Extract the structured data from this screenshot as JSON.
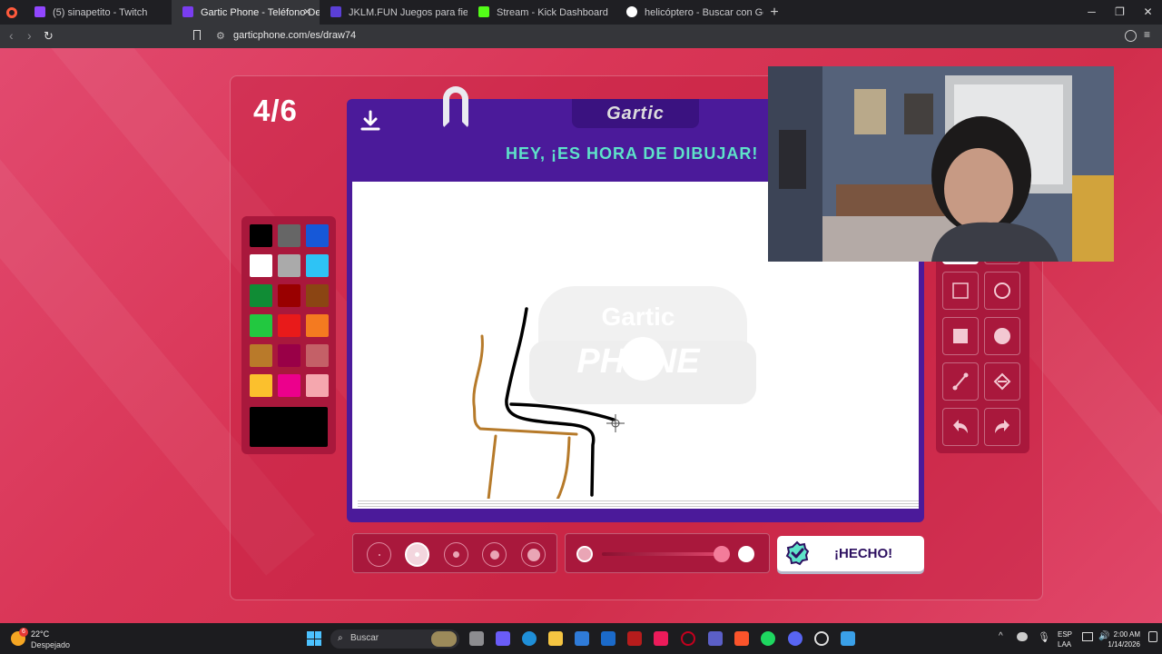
{
  "browser": {
    "tabs": [
      {
        "label": "(5) sinapetito - Twitch",
        "favicon_color": "#9146ff",
        "active": false
      },
      {
        "label": "Gartic Phone - Teléfono Descom",
        "favicon_color": "#7a3df0",
        "active": true
      },
      {
        "label": "JKLM.FUN Juegos para fiestas en PC",
        "favicon_color": "#5b3fd6",
        "active": false
      },
      {
        "label": "Stream - Kick Dashboard",
        "favicon_color": "#53fc18",
        "active": false
      },
      {
        "label": "helicóptero - Buscar con Google",
        "favicon_color": "#ffffff",
        "active": false
      }
    ],
    "url": "garticphone.com/es/draw74"
  },
  "game": {
    "round_counter": "4/6",
    "logo": "Gartic",
    "watermark_top": "Gartic",
    "watermark_bottom": "PHONE",
    "prompt": "HEY, ¡ES HORA DE DIBUJAR!",
    "palette": [
      "#000000",
      "#666666",
      "#1658d8",
      "#ffffff",
      "#aaaaaa",
      "#2ec3f5",
      "#108c35",
      "#990000",
      "#8b4513",
      "#22c840",
      "#e81a1a",
      "#f47a20",
      "#b97a2a",
      "#990047",
      "#c46067",
      "#fbc02d",
      "#ec008c",
      "#f5a7ae"
    ],
    "current_color": "#000000",
    "accent": "#4b1a9a",
    "prompt_color": "#5ee3c9",
    "done_label": "¡HECHO!",
    "selected_tool": "pencil",
    "selected_brush_size": 2
  },
  "taskbar": {
    "temperature": "22°C",
    "weather": "Despejado",
    "search_placeholder": "Buscar",
    "lang": "ESP",
    "layout": "LAA",
    "time": "2:00 AM",
    "date": "1/14/2026",
    "weather_badge": "6"
  }
}
